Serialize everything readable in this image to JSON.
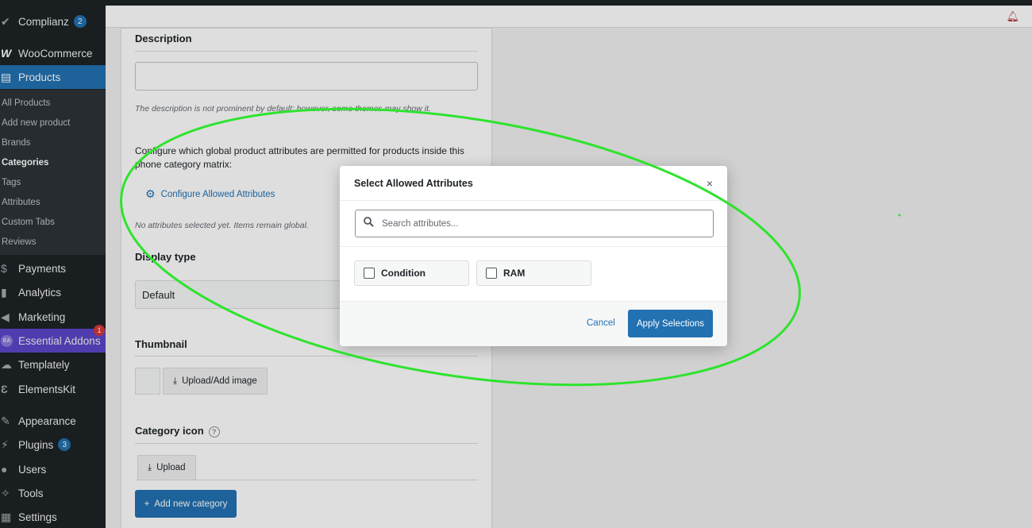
{
  "sidebar": {
    "top_items": [
      {
        "label": "Complianz",
        "badge": "2"
      },
      {
        "label": "WooCommerce"
      },
      {
        "label": "Products"
      }
    ],
    "sub_items": [
      "All Products",
      "Add new product",
      "Brands",
      "Categories",
      "Tags",
      "Attributes",
      "Custom Tabs",
      "Reviews"
    ],
    "items": [
      {
        "label": "Payments"
      },
      {
        "label": "Analytics"
      },
      {
        "label": "Marketing"
      },
      {
        "label": "Essential Addons",
        "badge": "1"
      },
      {
        "label": "Templately"
      },
      {
        "label": "ElementsKit"
      },
      {
        "label": "Appearance"
      },
      {
        "label": "Plugins",
        "badge": "3"
      },
      {
        "label": "Users"
      },
      {
        "label": "Tools"
      },
      {
        "label": "Settings"
      }
    ],
    "ea_icon_text": "EA"
  },
  "form": {
    "description_label": "Description",
    "description_hint": "The description is not prominent by default; however, some themes may show it.",
    "attributes_help": "Configure which global product attributes are permitted for products inside this phone category matrix:",
    "configure_link": "Configure Allowed Attributes",
    "no_attributes_hint": "No attributes selected yet. Items remain global.",
    "display_type_label": "Display type",
    "display_type_value": "Default",
    "thumbnail_label": "Thumbnail",
    "upload_image_label": "Upload/Add image",
    "category_icon_label": "Category icon",
    "help_glyph": "?",
    "upload_label": "Upload",
    "add_category_label": "Add new category"
  },
  "modal": {
    "title": "Select Allowed Attributes",
    "close_glyph": "×",
    "search_placeholder": "Search attributes...",
    "attributes": [
      {
        "label": "Condition",
        "checked": false
      },
      {
        "label": "RAM",
        "checked": false
      }
    ],
    "cancel_label": "Cancel",
    "apply_label": "Apply Selections"
  },
  "colors": {
    "accent": "#2271b1",
    "annotation": "#2ee32e",
    "sidebar_bg": "#1d2327"
  }
}
